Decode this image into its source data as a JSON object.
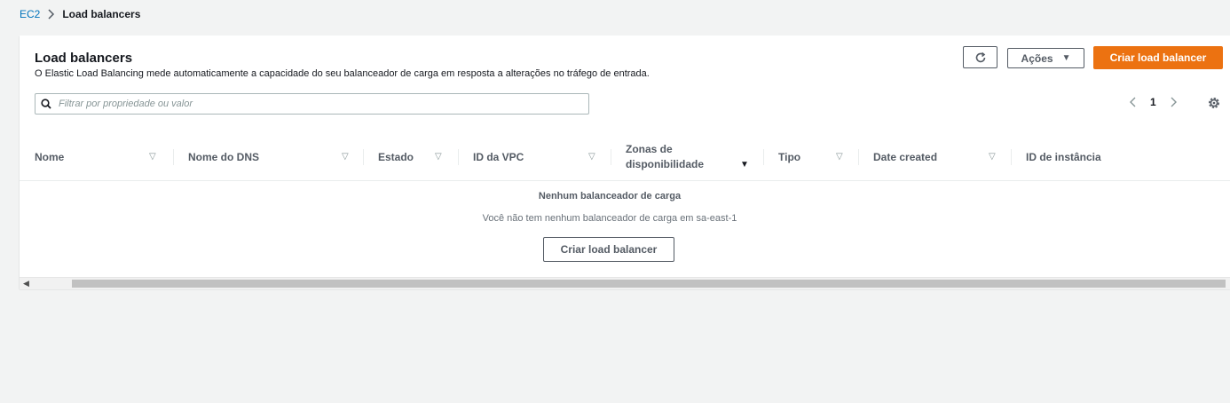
{
  "breadcrumb": {
    "root": "EC2",
    "current": "Load balancers"
  },
  "header": {
    "title": "Load balancers",
    "description": "O Elastic Load Balancing mede automaticamente a capacidade do seu balanceador de carga em resposta a alterações no tráfego de entrada.",
    "actions_label": "Ações",
    "create_label": "Criar load balancer"
  },
  "filter": {
    "placeholder": "Filtrar por propriedade ou valor",
    "value": ""
  },
  "pagination": {
    "current_page": "1"
  },
  "columns": {
    "name": "Nome",
    "dns": "Nome do DNS",
    "state": "Estado",
    "vpc": "ID da VPC",
    "zones_line1": "Zonas de",
    "zones_line2": "disponibilidade",
    "type": "Tipo",
    "created": "Date created",
    "instance": "ID de instância"
  },
  "empty_state": {
    "title": "Nenhum balanceador de carga",
    "message": "Você não tem nenhum balanceador de carga em sa-east-1",
    "button_label": "Criar load balancer"
  },
  "colors": {
    "primary": "#ec7211",
    "link": "#0073bb",
    "background": "#f2f3f3"
  },
  "icons": [
    "chevron-right-icon",
    "refresh-icon",
    "caret-down-icon",
    "search-icon",
    "chevron-left-icon",
    "settings-icon",
    "sort-icon"
  ]
}
